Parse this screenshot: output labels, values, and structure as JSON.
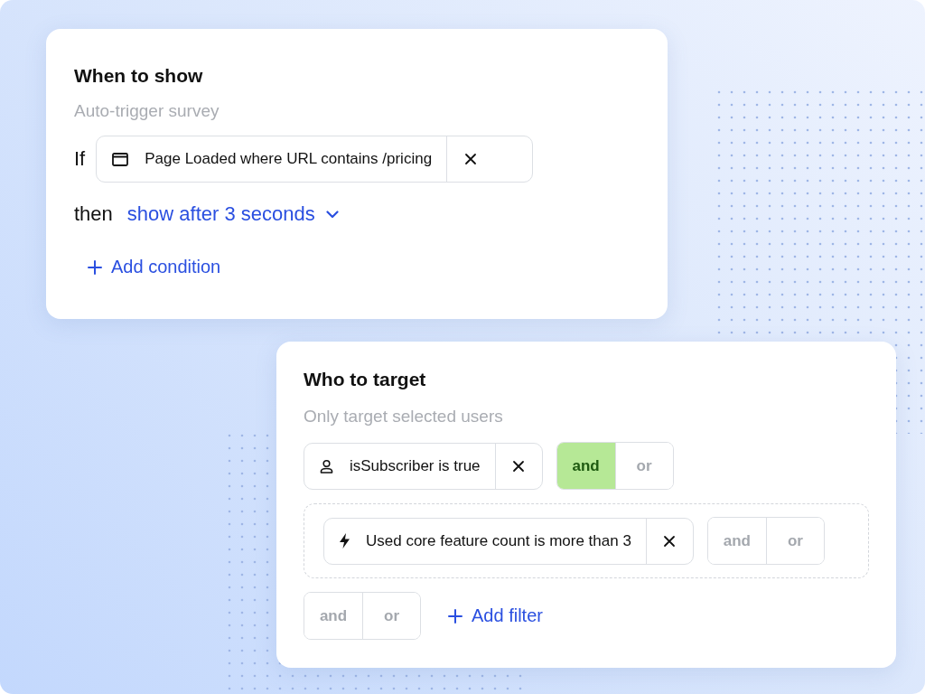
{
  "when_card": {
    "title": "When to show",
    "subtitle": "Auto-trigger survey",
    "if_label": "If",
    "condition": {
      "kind": "page",
      "text": "Page Loaded where URL contains /pricing"
    },
    "then_label": "then",
    "action": "show after 3 seconds",
    "add_label": "Add condition"
  },
  "target_card": {
    "title": "Who to target",
    "subtitle": "Only target selected users",
    "filters": [
      {
        "kind": "user",
        "text": "isSubscriber is true",
        "grouped": false,
        "joiner": [
          {
            "label": "and",
            "selected": true
          },
          {
            "label": "or",
            "selected": false
          }
        ]
      },
      {
        "kind": "event",
        "text": "Used core feature count is more than 3",
        "grouped": true,
        "joiner": [
          {
            "label": "and",
            "selected": false
          },
          {
            "label": "or",
            "selected": false
          }
        ]
      }
    ],
    "trailing_joiner": [
      {
        "label": "and",
        "selected": false
      },
      {
        "label": "or",
        "selected": false
      }
    ],
    "add_label": "Add filter"
  }
}
